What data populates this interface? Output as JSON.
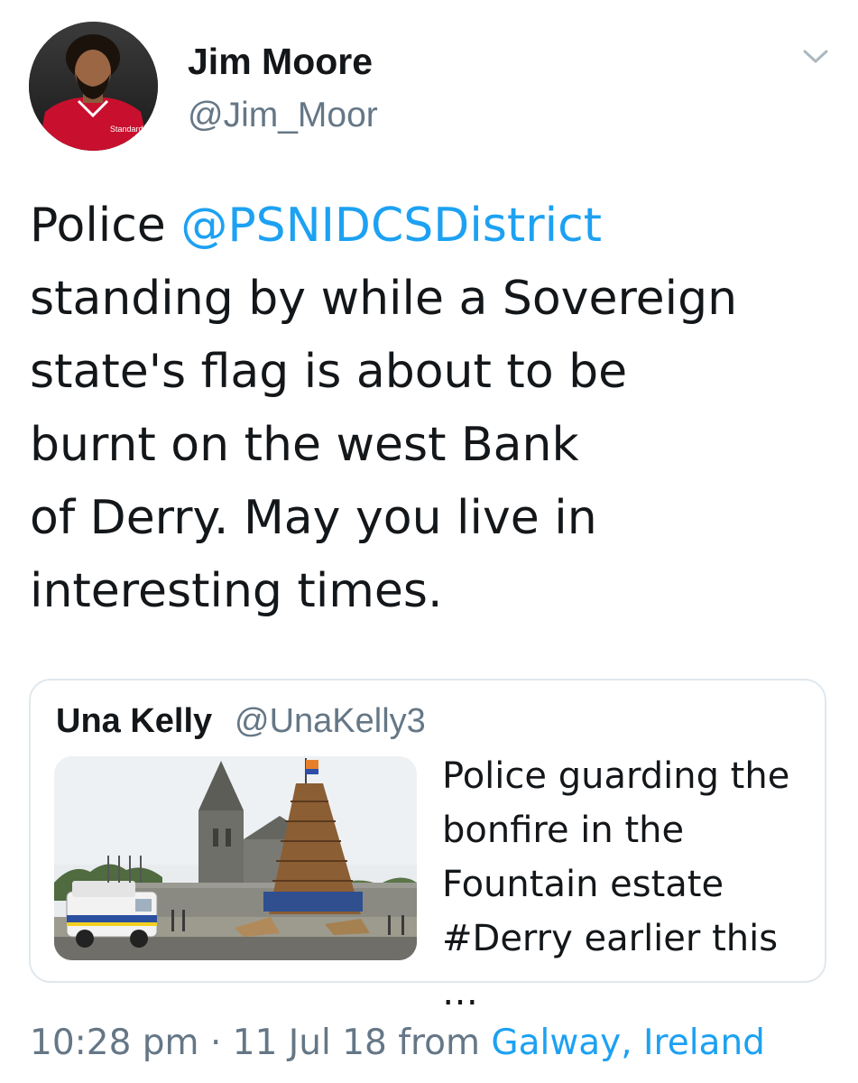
{
  "author": {
    "name": "Jim Moore",
    "handle": "@Jim_Moor",
    "avatar_icon": "avatar-photo",
    "avatar_shirt_text": "Standard Chartered"
  },
  "tweet": {
    "text_prefix": "Police ",
    "mention": "@PSNIDCSDistrict",
    "line2": "standing by while a Sovereign",
    "line3": "state's flag is about to be",
    "line4": "burnt on the west Bank",
    "line5": "of Derry. May you live in",
    "line6": "interesting times."
  },
  "quoted_tweet": {
    "name": "Una Kelly",
    "handle": "@UnaKelly3",
    "text_line1": "Police guarding the",
    "text_line2": "bonfire in the",
    "text_line3": "Fountain estate",
    "text_line4": "#Derry earlier this …",
    "image_icon": "bonfire-photo"
  },
  "meta": {
    "time": "10:28 pm",
    "separator": " · ",
    "date": "11 Jul 18",
    "from_label": " from ",
    "location": "Galway, Ireland"
  },
  "colors": {
    "link": "#1da1f2",
    "secondary_text": "#657786",
    "primary_text": "#14171a",
    "border": "#e1e8ed"
  }
}
